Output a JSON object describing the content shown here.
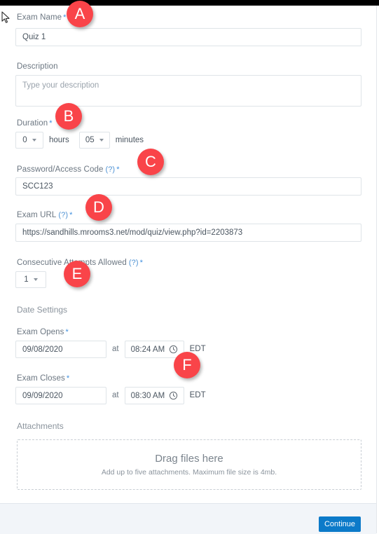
{
  "window": {
    "top_bar_color": "#000000",
    "accent_color": "#0c7ac9",
    "badge_color": "#f94449",
    "required_marker": "*",
    "help_marker": "(?)"
  },
  "form": {
    "exam_name": {
      "label": "Exam Name",
      "value": "Quiz 1"
    },
    "description": {
      "label": "Description",
      "value": "",
      "placeholder": "Type your description"
    },
    "duration": {
      "label": "Duration",
      "hours_value": "0",
      "hours_unit": "hours",
      "minutes_value": "05",
      "minutes_unit": "minutes"
    },
    "password": {
      "label": "Password/Access Code",
      "value": "SCC123"
    },
    "exam_url": {
      "label": "Exam URL",
      "value": "https://sandhills.mrooms3.net/mod/quiz/view.php?id=2203873"
    },
    "attempts": {
      "label": "Consecutive Attempts Allowed",
      "value": "1"
    },
    "date_settings": {
      "section_label": "Date Settings",
      "opens": {
        "label": "Exam Opens",
        "date": "09/08/2020",
        "at": "at",
        "time": "08:24 AM",
        "timezone": "EDT"
      },
      "closes": {
        "label": "Exam Closes",
        "date": "09/09/2020",
        "at": "at",
        "time": "08:30 AM",
        "timezone": "EDT"
      }
    },
    "attachments": {
      "label": "Attachments",
      "dropzone_title": "Drag files here",
      "dropzone_subtitle": "Add up to five attachments. Maximum file size is 4mb."
    }
  },
  "footer": {
    "continue_label": "Continue"
  },
  "annotations": [
    {
      "id": "A",
      "label": "A"
    },
    {
      "id": "B",
      "label": "B"
    },
    {
      "id": "C",
      "label": "C"
    },
    {
      "id": "D",
      "label": "D"
    },
    {
      "id": "E",
      "label": "E"
    },
    {
      "id": "F",
      "label": "F"
    }
  ]
}
